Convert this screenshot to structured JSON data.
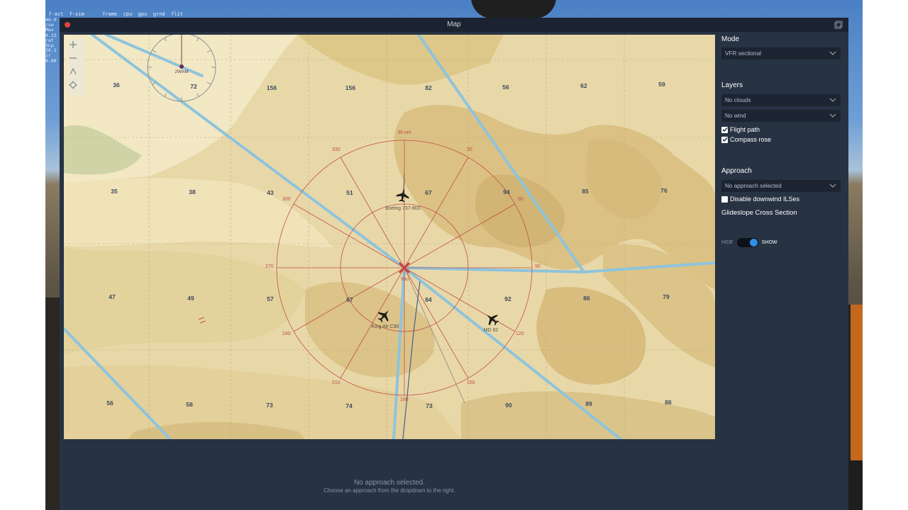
{
  "sim_overlay": {
    "stats_header": " f-act  f-sim      frame  cpu  gpu  grnd  flit",
    "left_values": [
      "40.0",
      "/se",
      "Max",
      "0.22",
      "rat",
      "SLp",
      "30.1",
      "ir",
      "0.00"
    ]
  },
  "window": {
    "title": "Map"
  },
  "map": {
    "grid_numbers": [
      {
        "id": "r1c1",
        "value": "36"
      },
      {
        "id": "r1c2",
        "value": "72"
      },
      {
        "id": "r1c3",
        "value": "156"
      },
      {
        "id": "r1c4",
        "value": "156"
      },
      {
        "id": "r1c5",
        "value": "82"
      },
      {
        "id": "r1c6",
        "value": "56"
      },
      {
        "id": "r1c7",
        "value": "62"
      },
      {
        "id": "r1c8",
        "value": "59"
      },
      {
        "id": "r2c1",
        "value": "35"
      },
      {
        "id": "r2c2",
        "value": "38"
      },
      {
        "id": "r2c3",
        "value": "43"
      },
      {
        "id": "r2c4",
        "value": "51"
      },
      {
        "id": "r2c5",
        "value": "67"
      },
      {
        "id": "r2c6",
        "value": "94"
      },
      {
        "id": "r2c7",
        "value": "85"
      },
      {
        "id": "r2c8",
        "value": "76"
      },
      {
        "id": "r3c1",
        "value": "47"
      },
      {
        "id": "r3c2",
        "value": "49"
      },
      {
        "id": "r3c3",
        "value": "57"
      },
      {
        "id": "r3c4",
        "value": "67"
      },
      {
        "id": "r3c5",
        "value": "84"
      },
      {
        "id": "r3c6",
        "value": "92"
      },
      {
        "id": "r3c7",
        "value": "86"
      },
      {
        "id": "r3c8",
        "value": "79"
      },
      {
        "id": "r4c1",
        "value": "56"
      },
      {
        "id": "r4c2",
        "value": "58"
      },
      {
        "id": "r4c3",
        "value": "73"
      },
      {
        "id": "r4c4",
        "value": "74"
      },
      {
        "id": "r4c5",
        "value": "73"
      },
      {
        "id": "r4c6",
        "value": "90"
      },
      {
        "id": "r4c7",
        "value": "89"
      },
      {
        "id": "r4c8",
        "value": "86"
      }
    ],
    "range_label": "36 nm",
    "bearing_labels": {
      "b30": "30",
      "b60": "60",
      "b90": "90",
      "b120": "120",
      "b150": "150",
      "b180": "180",
      "b210": "210",
      "b240": "240",
      "b270": "270",
      "b300": "300",
      "b330": "330"
    },
    "own_aircraft_label": "You",
    "traffic": [
      {
        "label": "Boeing 737-800"
      },
      {
        "label": "King Air C90"
      },
      {
        "label": "MD 82"
      }
    ],
    "waypoint_label": "2WAM"
  },
  "sidebar": {
    "mode_heading": "Mode",
    "mode_value": "VFR sectional",
    "layers_heading": "Layers",
    "clouds_value": "No clouds",
    "wind_value": "No wind",
    "flight_path_label": "Flight path",
    "flight_path_checked": true,
    "compass_rose_label": "Compass rose",
    "compass_rose_checked": true,
    "approach_heading": "Approach",
    "approach_value": "No approach selected",
    "disable_ils_label": "Disable downwind ILSes",
    "disable_ils_checked": false,
    "glideslope_label": "Glideslope Cross Section",
    "toggle_hide": "HIDE",
    "toggle_show": "SHOW"
  },
  "bottom": {
    "title": "No approach selected.",
    "subtitle": "Choose an approach from the dropdown to the right."
  },
  "colors": {
    "window_bg": "#273243",
    "map_base": "#e6d6a6",
    "route_blue": "#8ec4dc",
    "rose_red": "#c0504a",
    "toggle_blue": "#2e8fe6"
  }
}
